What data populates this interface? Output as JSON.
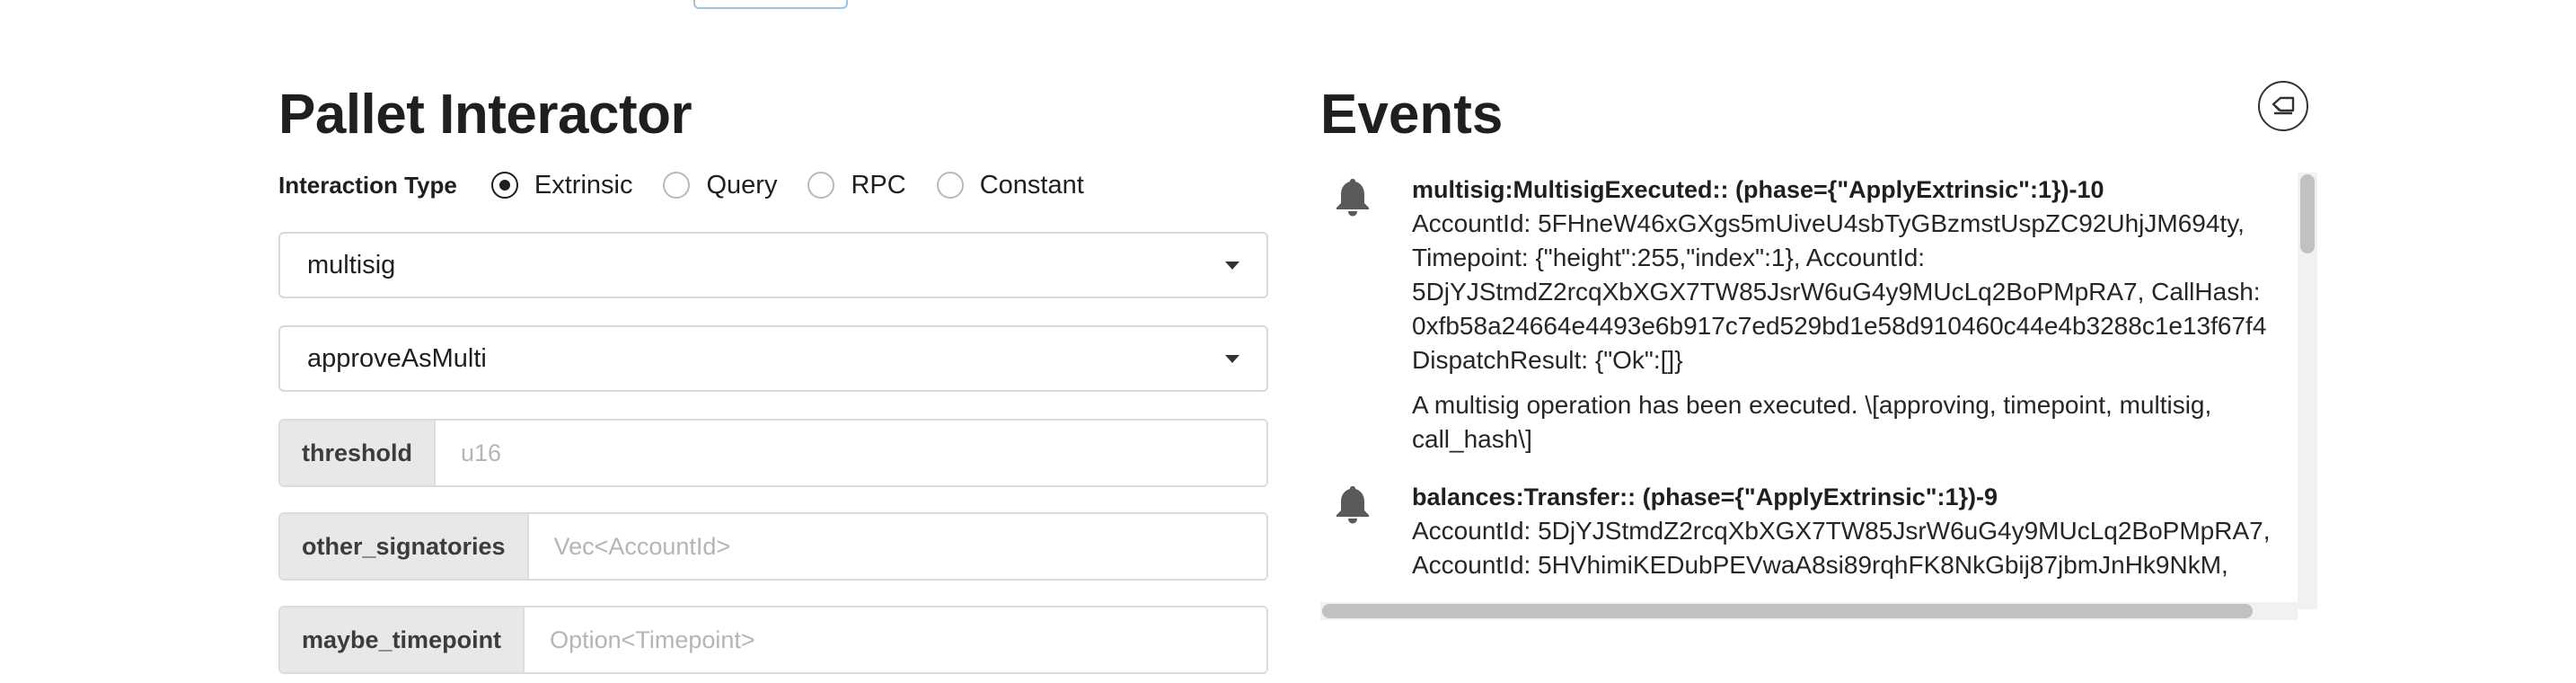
{
  "pallet": {
    "title": "Pallet Interactor",
    "interaction_type_label": "Interaction Type",
    "interaction_types": [
      {
        "label": "Extrinsic",
        "selected": true
      },
      {
        "label": "Query",
        "selected": false
      },
      {
        "label": "RPC",
        "selected": false
      },
      {
        "label": "Constant",
        "selected": false
      }
    ],
    "pallet_select": "multisig",
    "callable_select": "approveAsMulti",
    "params": [
      {
        "label": "threshold",
        "placeholder": "u16",
        "value": ""
      },
      {
        "label": "other_signatories",
        "placeholder": "Vec<AccountId>",
        "value": ""
      },
      {
        "label": "maybe_timepoint",
        "placeholder": "Option<Timepoint>",
        "value": ""
      }
    ]
  },
  "events": {
    "title": "Events",
    "clear_icon": "eraser-icon",
    "items": [
      {
        "icon": "bell-icon",
        "title": "multisig:MultisigExecuted:: (phase={\"ApplyExtrinsic\":1})-10",
        "lines": [
          "AccountId: 5FHneW46xGXgs5mUiveU4sbTyGBzmstUspZC92UhjJM694ty,",
          "Timepoint: {\"height\":255,\"index\":1}, AccountId:",
          "5DjYJStmdZ2rcqXbXGX7TW85JsrW6uG4y9MUcLq2BoPMpRA7, CallHash:",
          "0xfb58a24664e4493e6b917c7ed529bd1e58d910460c44e4b3288c1e13f67f4",
          "DispatchResult: {\"Ok\":[]}"
        ],
        "description": "A multisig operation has been executed. \\[approving, timepoint, multisig, call_hash\\]"
      },
      {
        "icon": "bell-icon",
        "title": "balances:Transfer:: (phase={\"ApplyExtrinsic\":1})-9",
        "lines": [
          "AccountId: 5DjYJStmdZ2rcqXbXGX7TW85JsrW6uG4y9MUcLq2BoPMpRA7,",
          "AccountId: 5HVhimiKEDubPEVwaA8si89rqhFK8NkGbij87jbmJnHk9NkM,"
        ],
        "description": ""
      }
    ]
  }
}
